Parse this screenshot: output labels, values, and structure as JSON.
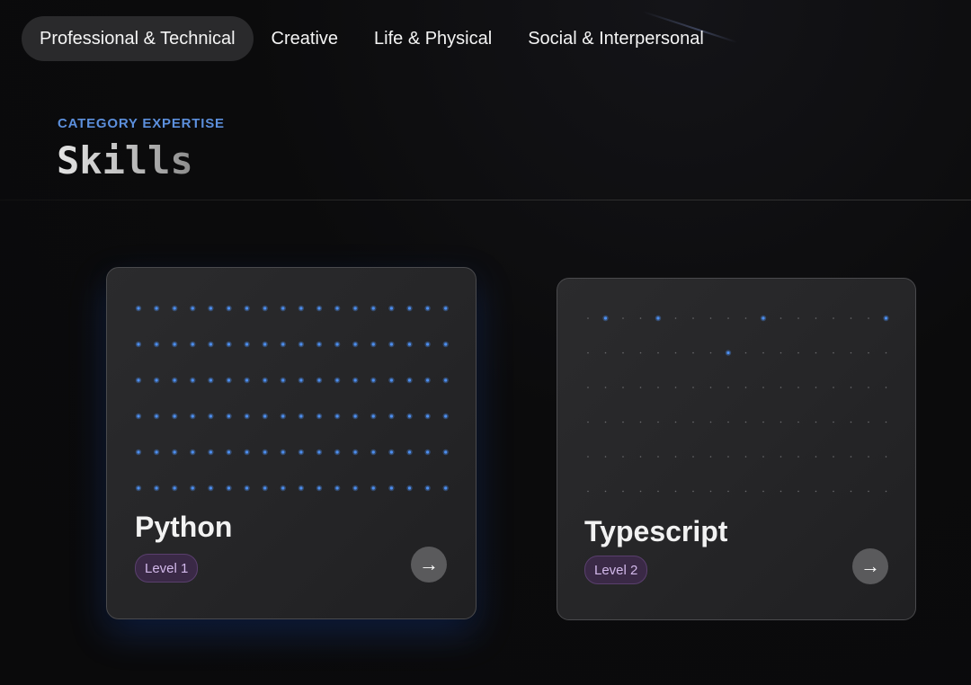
{
  "tabs": [
    {
      "label": "Professional & Technical",
      "active": true
    },
    {
      "label": "Creative",
      "active": false
    },
    {
      "label": "Life & Physical",
      "active": false
    },
    {
      "label": "Social & Interpersonal",
      "active": false
    }
  ],
  "header": {
    "eyebrow": "CATEGORY EXPERTISE",
    "title": "Skills"
  },
  "cards": [
    {
      "name": "Python",
      "level": "Level 1",
      "arrow": "→",
      "highlighted": true,
      "dot_color": "#4d8ff0"
    },
    {
      "name": "Typescript",
      "level": "Level 2",
      "arrow": "→",
      "highlighted": false,
      "dot_color": "#4d8ff0"
    }
  ],
  "colors": {
    "background": "#0b0b0c",
    "accent_blue": "#5c8fdc",
    "badge_bg": "#3a2946",
    "badge_text": "#d2b8ea",
    "card_bg": "#2a2a2c"
  }
}
